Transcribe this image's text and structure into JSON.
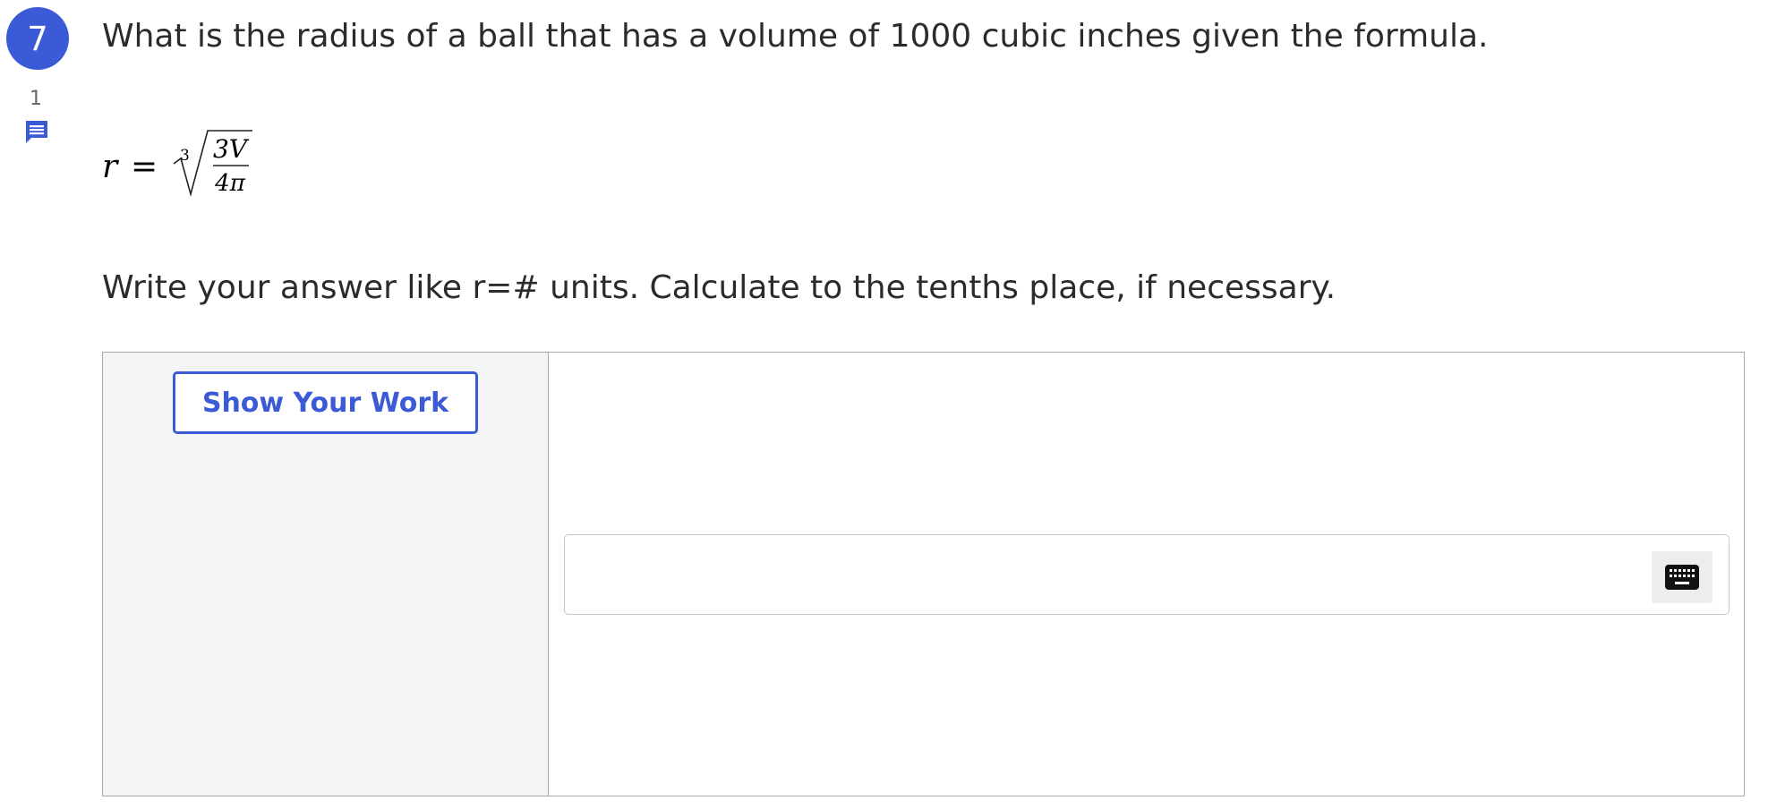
{
  "question": {
    "number": "7",
    "comment_count": "1",
    "text": "What is the radius of a ball that has a volume of 1000 cubic inches given the formula.",
    "formula": {
      "lhs": "r",
      "equals": "=",
      "root_index": "3",
      "numerator": "3V",
      "denominator": "4π"
    },
    "instructions": "Write your answer like r=# units. Calculate to the tenths place, if necessary."
  },
  "work_area": {
    "show_work_label": "Show Your Work",
    "answer_value": ""
  },
  "icons": {
    "comment": "comment-icon",
    "keyboard": "keyboard-icon"
  },
  "colors": {
    "accent": "#3b5bd6",
    "panel_bg": "#f3f4f5",
    "border": "#a8a8a8"
  }
}
